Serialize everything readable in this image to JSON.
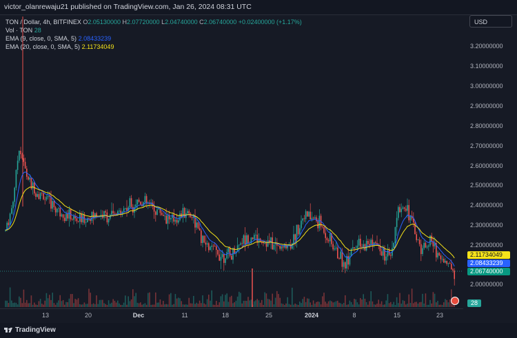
{
  "header": {
    "published_text": "victor_olanrewaju21 published on TradingView.com, Jan 26, 2024 08:31 UTC"
  },
  "legend": {
    "symbol": "TON / Dollar, 4h, BITFINEX",
    "open_label": "O",
    "open": "2.05130000",
    "high_label": "H",
    "high": "2.07720000",
    "low_label": "L",
    "low": "2.04740000",
    "close_label": "C",
    "close": "2.06740000",
    "change": "+0.02400000 (+1.17%)",
    "volume_label": "Vol · TON",
    "volume": "28",
    "ema9_label": "EMA (9, close, 0, SMA, 5)",
    "ema9_value": "2.08433239",
    "ema20_label": "EMA (20, close, 0, SMA, 5)",
    "ema20_value": "2.11734049"
  },
  "currency_button": "USD",
  "price_axis": {
    "ticks": [
      "3.20000000",
      "3.10000000",
      "3.00000000",
      "2.90000000",
      "2.80000000",
      "2.70000000",
      "2.60000000",
      "2.50000000",
      "2.40000000",
      "2.30000000",
      "2.20000000",
      "2.00000000"
    ],
    "tags": {
      "ema20": "2.11734049",
      "ema9": "2.08433239",
      "price": "2.06740000",
      "volume": "28"
    }
  },
  "time_axis": {
    "labels": [
      "13",
      "20",
      "Dec",
      "11",
      "18",
      "25",
      "2024",
      "8",
      "15",
      "23"
    ]
  },
  "colors": {
    "up": "#26a69a",
    "down": "#ef5350",
    "ema9": "#2962ff",
    "ema20": "#f5e31a",
    "background": "#161a25"
  },
  "footer": {
    "brand": "TradingView"
  }
}
